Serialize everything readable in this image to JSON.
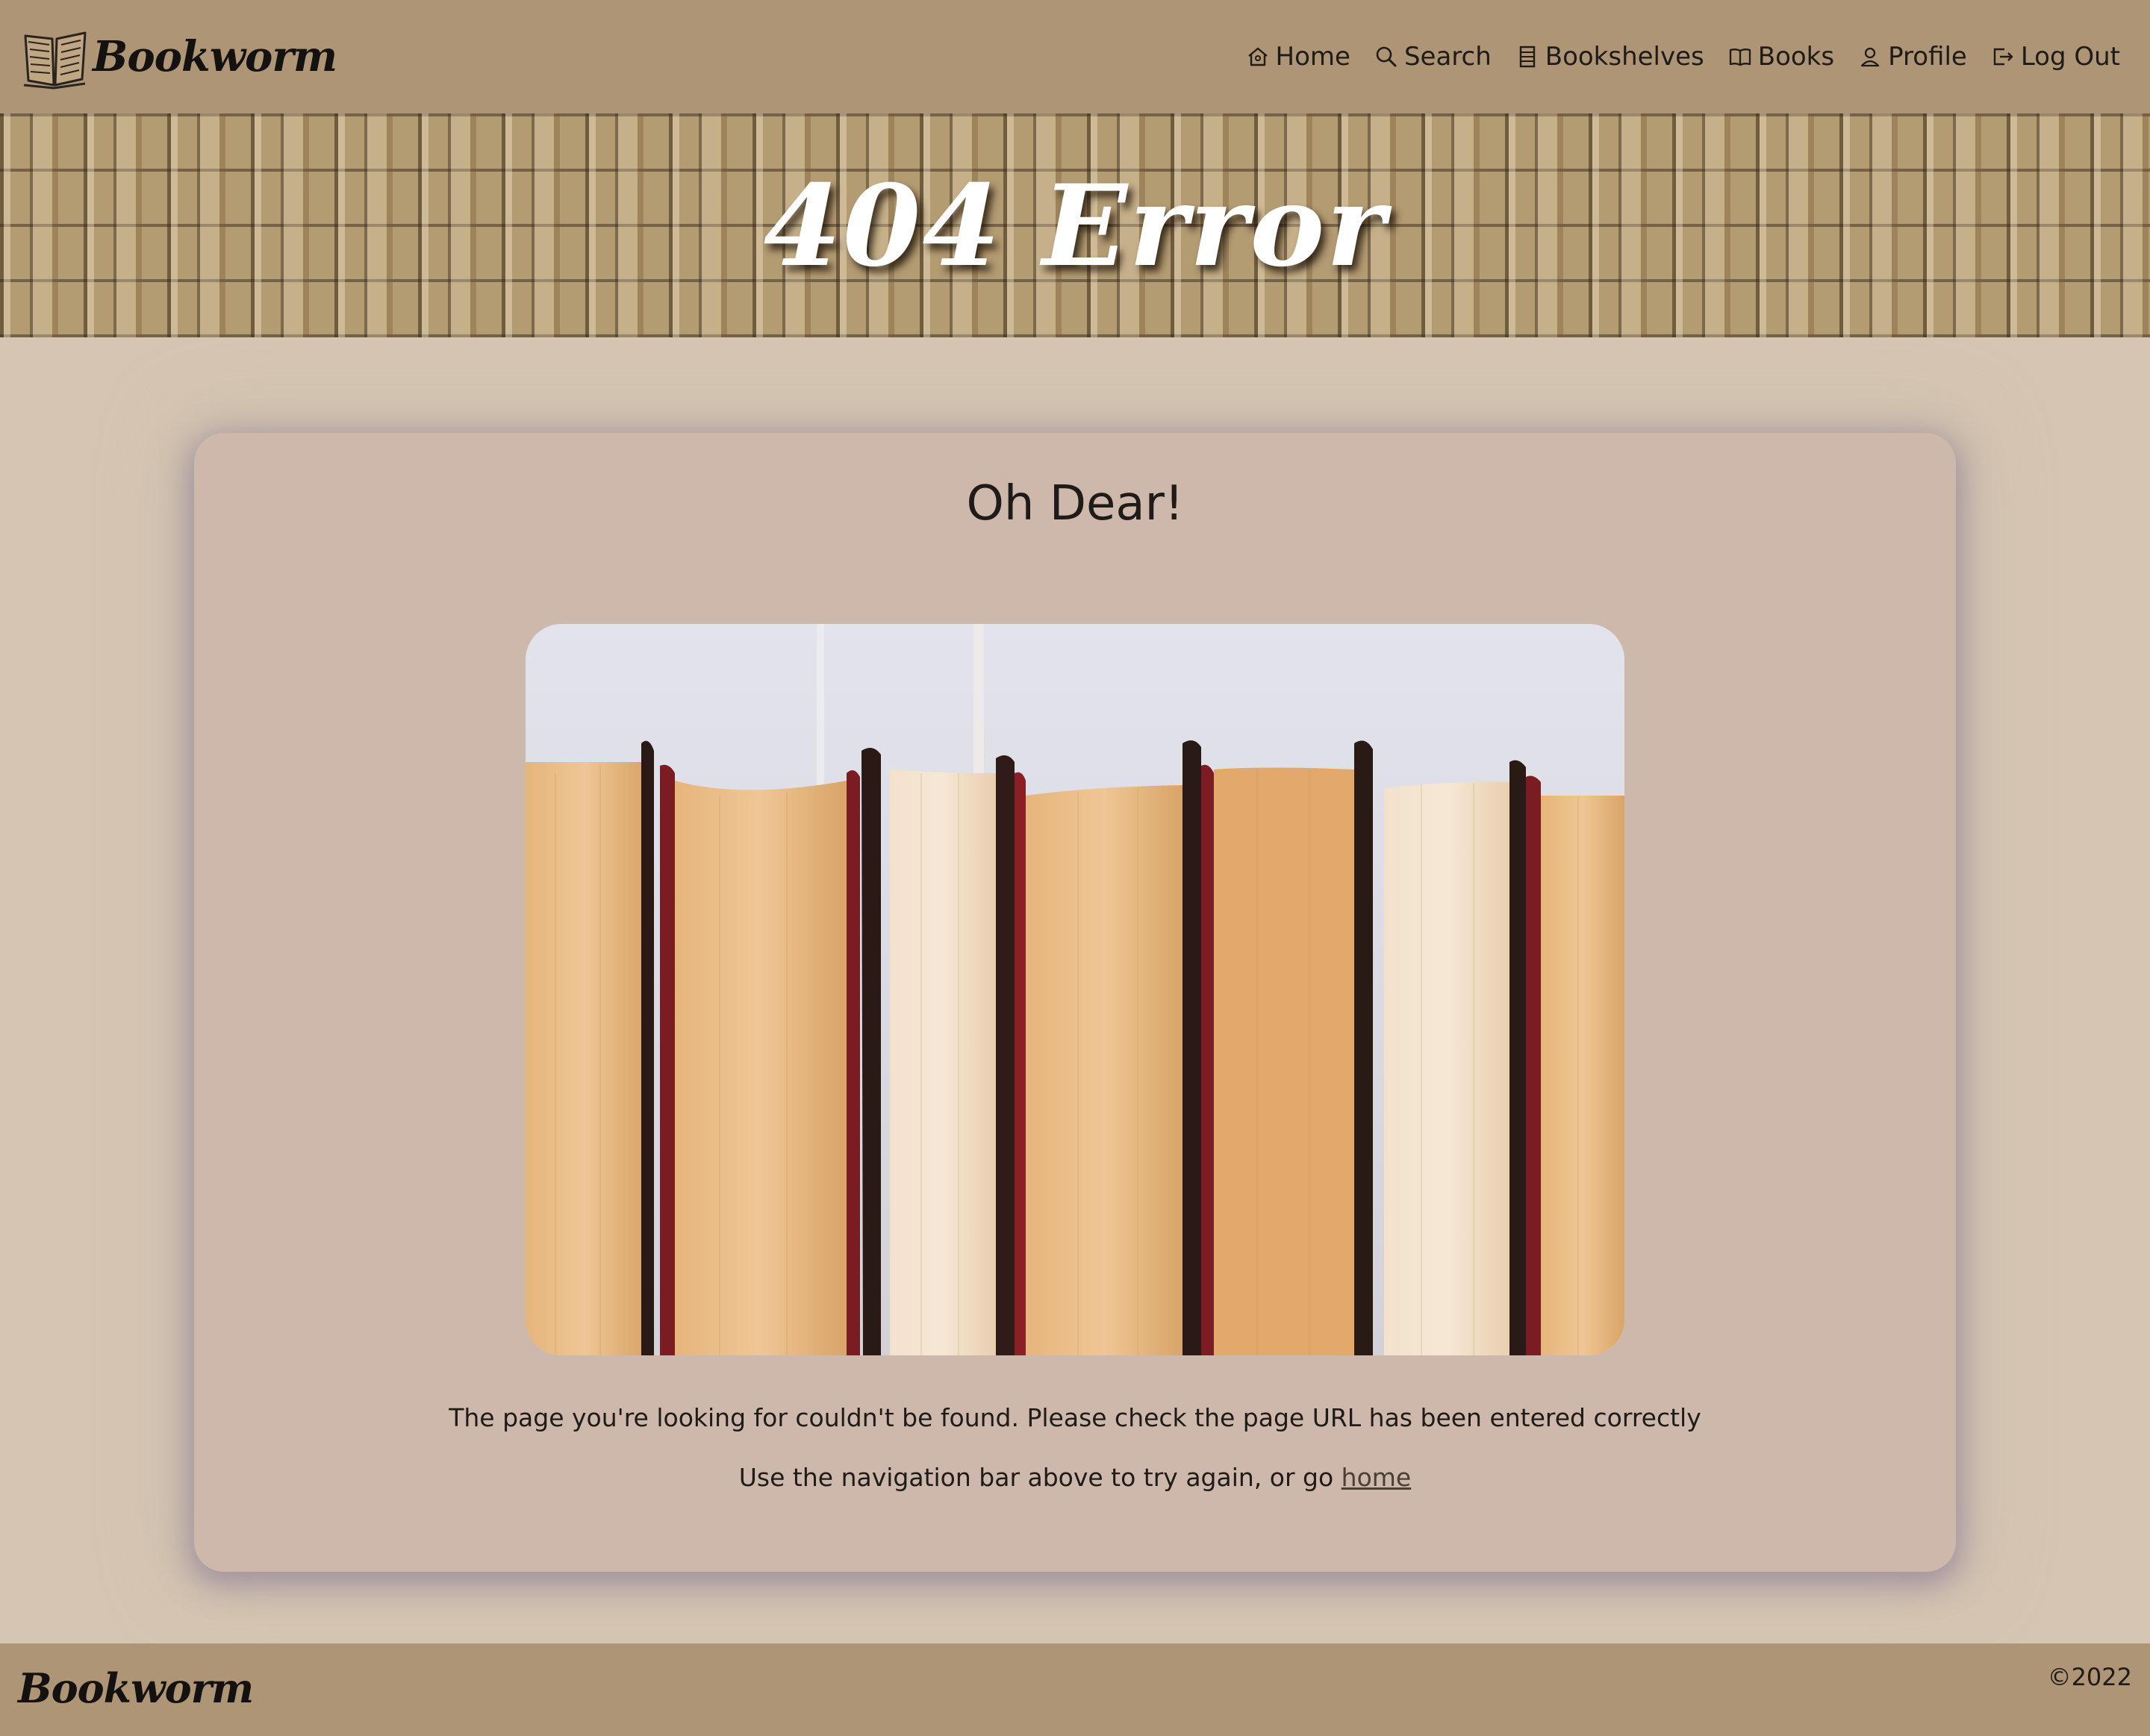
{
  "brand": {
    "name": "Bookworm"
  },
  "nav": {
    "items": [
      {
        "label": "Home",
        "icon": "home-icon"
      },
      {
        "label": "Search",
        "icon": "search-icon"
      },
      {
        "label": "Bookshelves",
        "icon": "bookshelf-icon"
      },
      {
        "label": "Books",
        "icon": "book-icon"
      },
      {
        "label": "Profile",
        "icon": "user-icon"
      },
      {
        "label": "Log Out",
        "icon": "logout-icon"
      }
    ]
  },
  "hero": {
    "title": "404 Error"
  },
  "main": {
    "heading": "Oh Dear!",
    "image_alt": "row of old books",
    "message": "The page you're looking for couldn't be found. Please check the page URL has been entered correctly",
    "help_prefix": "Use the navigation bar above to try again, or go ",
    "home_link": "home"
  },
  "footer": {
    "brand": "Bookworm",
    "copyright": "©2022"
  },
  "colors": {
    "nav_bg": "#ad9575",
    "page_bg": "#d5c5b2",
    "card_bg": "#cdb8ab",
    "text": "#1e1b18"
  }
}
